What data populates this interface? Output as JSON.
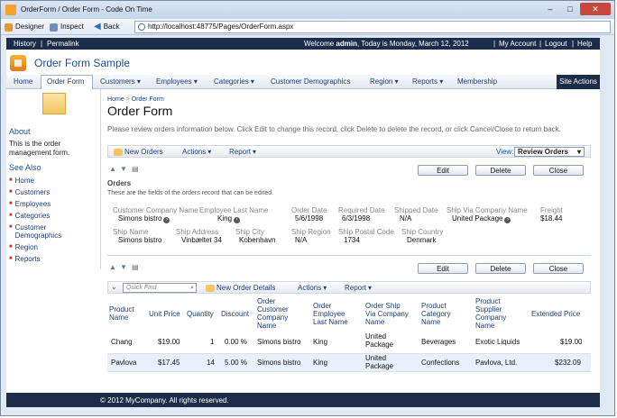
{
  "window": {
    "title": "OrderForm / Order Form - Code On Time"
  },
  "browser": {
    "designer": "Designer",
    "inspect": "Inspect",
    "back": "Back",
    "url": "http://localhost:48775/Pages/OrderForm.aspx"
  },
  "topbar": {
    "history": "History",
    "permalink": "Permalink",
    "welcome_prefix": "Welcome ",
    "user": "admin",
    "welcome_suffix": ", Today is Monday, March 12, 2012",
    "my_account": "My Account",
    "logout": "Logout",
    "help": "Help"
  },
  "app": {
    "title": "Order Form Sample"
  },
  "menu": {
    "items": [
      "Home",
      "Order Form",
      "Customers",
      "Employees",
      "Categories",
      "Customer Demographics",
      "Region",
      "Reports",
      "Membership"
    ],
    "site_actions": "Site Actions"
  },
  "sidebar": {
    "about_title": "About",
    "about_text": "This is the order management form.",
    "see_also_title": "See Also",
    "links": [
      "Home",
      "Customers",
      "Employees",
      "Categories",
      "Customer Demographics",
      "Region",
      "Reports"
    ]
  },
  "breadcrumb": {
    "home": "Home",
    "sep": ">",
    "current": "Order Form"
  },
  "page": {
    "title": "Order Form",
    "description": "Please review orders information below. Click Edit to change this record, click Delete to delete the record, or click Cancel/Close to return back."
  },
  "actionbar": {
    "new_orders": "New Orders",
    "actions": "Actions",
    "report": "Report",
    "view_label": "View:",
    "view_value": "Review Orders"
  },
  "buttons": {
    "edit": "Edit",
    "delete": "Delete",
    "close": "Close"
  },
  "orders": {
    "title": "Orders",
    "description": "These are the fields of the orders record that can be edited.",
    "fields": [
      {
        "label": "Customer Company Name",
        "value": "Simons bistro"
      },
      {
        "label": "Employee Last Name",
        "value": "King"
      },
      {
        "label": "Order Date",
        "value": "5/6/1998"
      },
      {
        "label": "Required Date",
        "value": "6/3/1998"
      },
      {
        "label": "Shipped Date",
        "value": "N/A"
      },
      {
        "label": "Ship Via Company Name",
        "value": "United Package"
      },
      {
        "label": "Freight",
        "value": "$18.44"
      },
      {
        "label": "Ship Name",
        "value": "Simons bistro"
      },
      {
        "label": "Ship Address",
        "value": "Vinbæltet 34"
      },
      {
        "label": "Ship City",
        "value": "Kobenhavn"
      },
      {
        "label": "Ship Region",
        "value": "N/A"
      },
      {
        "label": "Ship Postal Code",
        "value": "1734"
      },
      {
        "label": "Ship Country",
        "value": "Denmark"
      }
    ]
  },
  "details": {
    "quick_find": "Quick Find",
    "new_details": "New Order Details",
    "actions": "Actions",
    "report": "Report",
    "columns": [
      "Product Name",
      "Unit Price",
      "Quantity",
      "Discount",
      "Order Customer Company Name",
      "Order Employee Last Name",
      "Order Ship Via Company Name",
      "Product Category Name",
      "Product Supplier Company Name",
      "Extended Price"
    ],
    "rows": [
      [
        "Chang",
        "$19.00",
        "1",
        "0.00 %",
        "Simons bistro",
        "King",
        "United Package",
        "Beverages",
        "Exotic Liquids",
        "$19.00"
      ],
      [
        "Pavlova",
        "$17.45",
        "14",
        "5.00 %",
        "Simons bistro",
        "King",
        "United Package",
        "Confections",
        "Pavlova, Ltd.",
        "$232.09"
      ]
    ]
  },
  "footer": {
    "text": "© 2012 MyCompany. All rights reserved."
  }
}
